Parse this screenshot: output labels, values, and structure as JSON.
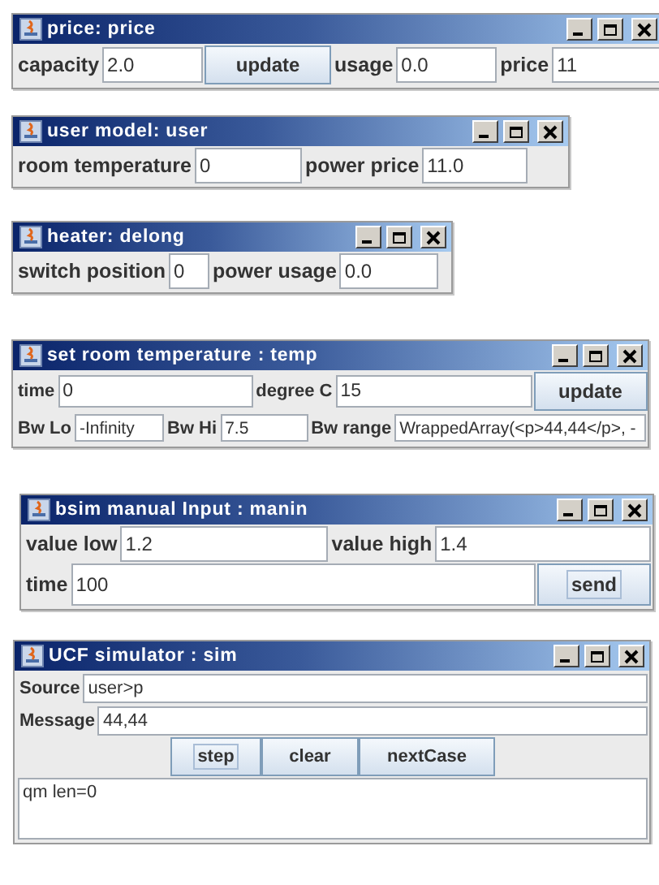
{
  "windows": [
    {
      "title": "price: price",
      "rows": [
        {
          "controls": [
            {
              "kind": "label",
              "text": "capacity"
            },
            {
              "kind": "field",
              "value": "2.0"
            },
            {
              "kind": "button",
              "text": "update",
              "focused": false
            },
            {
              "kind": "label",
              "text": "usage"
            },
            {
              "kind": "field",
              "value": "0.0"
            },
            {
              "kind": "label",
              "text": "price"
            },
            {
              "kind": "field",
              "value": "11"
            }
          ]
        }
      ]
    },
    {
      "title": "user model: user",
      "rows": [
        {
          "controls": [
            {
              "kind": "label",
              "text": "room temperature"
            },
            {
              "kind": "field",
              "value": "0"
            },
            {
              "kind": "label",
              "text": "power price"
            },
            {
              "kind": "field",
              "value": "11.0"
            }
          ]
        }
      ]
    },
    {
      "title": "heater: delong",
      "rows": [
        {
          "controls": [
            {
              "kind": "label",
              "text": "switch position"
            },
            {
              "kind": "field",
              "value": "0"
            },
            {
              "kind": "label",
              "text": "power usage"
            },
            {
              "kind": "field",
              "value": "0.0"
            }
          ]
        }
      ]
    },
    {
      "title": "set room temperature : temp",
      "rows": [
        {
          "controls": [
            {
              "kind": "label",
              "text": "time"
            },
            {
              "kind": "field",
              "value": "0"
            },
            {
              "kind": "label",
              "text": "degree C"
            },
            {
              "kind": "field",
              "value": "15"
            },
            {
              "kind": "button",
              "text": "update",
              "focused": false
            }
          ]
        },
        {
          "controls": [
            {
              "kind": "label",
              "text": "Bw Lo"
            },
            {
              "kind": "field",
              "value": "-Infinity"
            },
            {
              "kind": "label",
              "text": "Bw Hi"
            },
            {
              "kind": "field",
              "value": "7.5"
            },
            {
              "kind": "label",
              "text": "Bw range"
            },
            {
              "kind": "field",
              "value": "WrappedArray(<p>44,44</p>, -"
            }
          ]
        }
      ]
    },
    {
      "title": "bsim manual Input : manin",
      "rows": [
        {
          "controls": [
            {
              "kind": "label",
              "text": "value low"
            },
            {
              "kind": "field",
              "value": "1.2"
            },
            {
              "kind": "label",
              "text": "value high"
            },
            {
              "kind": "field",
              "value": "1.4"
            }
          ]
        },
        {
          "controls": [
            {
              "kind": "label",
              "text": "time"
            },
            {
              "kind": "field",
              "value": "100"
            },
            {
              "kind": "button",
              "text": "send",
              "focused": true
            }
          ]
        }
      ]
    },
    {
      "title": "UCF simulator : sim",
      "rows": [
        {
          "controls": [
            {
              "kind": "label",
              "text": "Source"
            },
            {
              "kind": "field",
              "value": "user>p"
            }
          ]
        },
        {
          "controls": [
            {
              "kind": "label",
              "text": "Message"
            },
            {
              "kind": "field",
              "value": "44,44"
            }
          ]
        },
        {
          "controls": [
            {
              "kind": "button",
              "text": "step",
              "focused": true
            },
            {
              "kind": "button",
              "text": "clear",
              "focused": false
            },
            {
              "kind": "button",
              "text": "nextCase",
              "focused": false
            }
          ]
        },
        {
          "controls": [
            {
              "kind": "textarea",
              "value": "qm len=0"
            }
          ]
        }
      ]
    }
  ]
}
